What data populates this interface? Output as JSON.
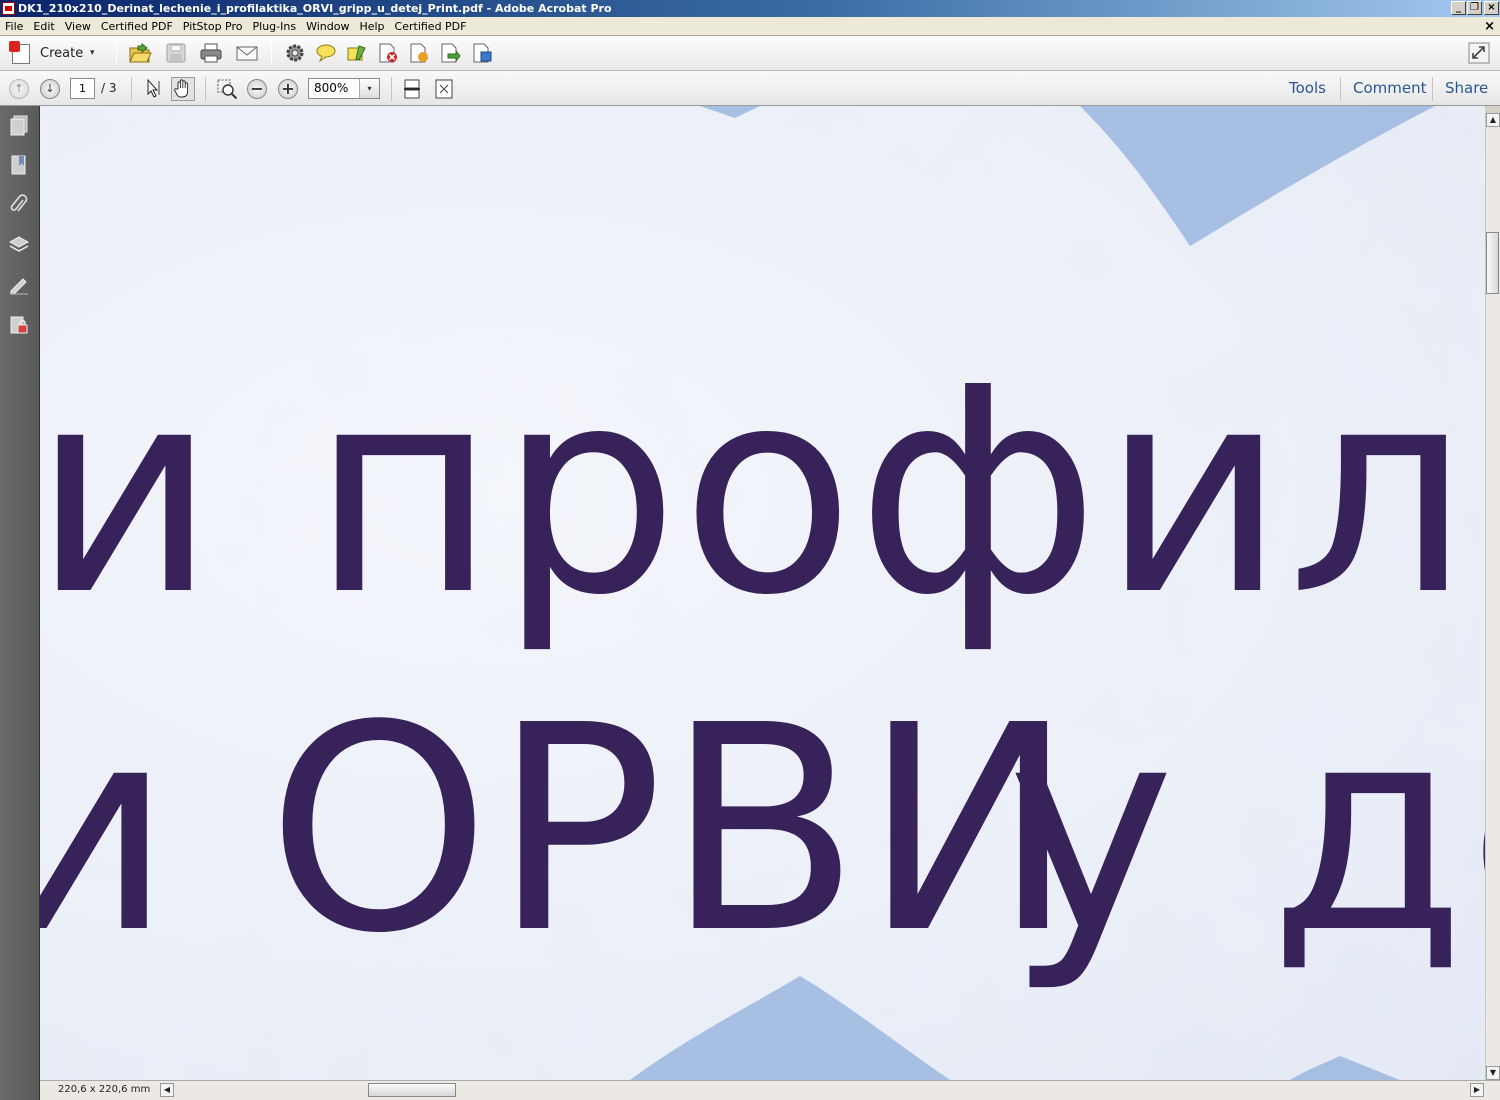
{
  "window": {
    "title": "DK1_210x210_Derinat_lechenie_i_profilaktika_ORVI_gripp_u_detej_Print.pdf - Adobe Acrobat Pro",
    "minimize": "_",
    "restore": "❐",
    "close": "×"
  },
  "menu": {
    "items": [
      "File",
      "Edit",
      "View",
      "Certified PDF",
      "PitStop Pro",
      "Plug-Ins",
      "Window",
      "Help",
      "Certified PDF"
    ],
    "close": "×"
  },
  "toolbar": {
    "create_label": "Create",
    "create_caret": "▾"
  },
  "navigation": {
    "page_current": "1",
    "page_total": "/ 3",
    "zoom": "800%",
    "zoom_caret": "▾"
  },
  "panels": {
    "tools": "Tools",
    "comment": "Comment",
    "share": "Share"
  },
  "document": {
    "line1": "и профилак",
    "line2a": "и ОРВИ",
    "line2b": "у де",
    "text_color": "#37235a",
    "blob_color": "#9fb9e0"
  },
  "status": {
    "page_size": "220,6 x 220,6 mm"
  },
  "scroll": {
    "up": "▲",
    "down": "▼",
    "left": "◀",
    "right": "▶"
  }
}
